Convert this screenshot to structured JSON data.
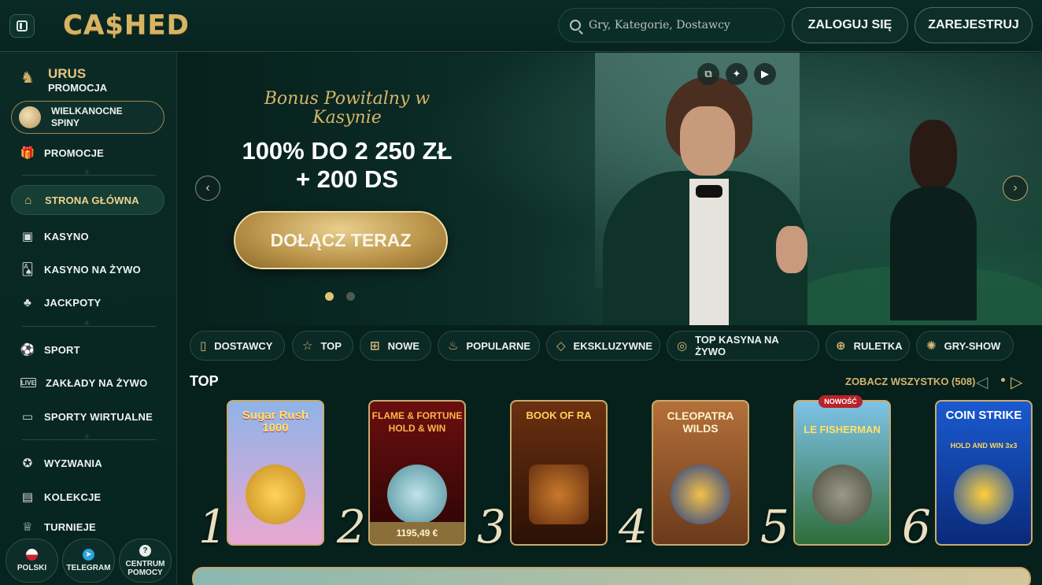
{
  "header": {
    "logo": "CA$HED",
    "search_placeholder": "Gry, Kategorie, Dostawcy",
    "login_label": "ZALOGUJ SIĘ",
    "register_label": "ZAREJESTRUJ"
  },
  "sidebar": {
    "urus_title": "URUS",
    "urus_subtitle": "PROMOCJA",
    "easter_label": "WIELKANOCNE SPINY",
    "items": [
      {
        "label": "PROMOCJE",
        "icon": "gift-icon"
      },
      {
        "label": "STRONA GŁÓWNA",
        "icon": "home-icon"
      },
      {
        "label": "KASYNO",
        "icon": "slot-icon"
      },
      {
        "label": "KASYNO NA ŻYWO",
        "icon": "cards-icon"
      },
      {
        "label": "JACKPOTY",
        "icon": "clover-icon"
      },
      {
        "label": "SPORT",
        "icon": "ball-icon"
      },
      {
        "label": "ZAKŁADY NA ŻYWO",
        "icon": "live-icon"
      },
      {
        "label": "SPORTY WIRTUALNE",
        "icon": "virtual-icon"
      },
      {
        "label": "WYZWANIA",
        "icon": "challenge-icon"
      },
      {
        "label": "KOLEKCJE",
        "icon": "collection-icon"
      },
      {
        "label": "TURNIEJE",
        "icon": "trophy-icon"
      }
    ],
    "bottom": [
      {
        "label": "POLSKI",
        "icon": "flag-pl-icon"
      },
      {
        "label": "TELEGRAM",
        "icon": "telegram-icon"
      },
      {
        "label": "CENTRUM POMOCY",
        "icon": "help-icon"
      }
    ]
  },
  "banner": {
    "script_text": "Bonus Powitalny w Kasynie",
    "headline": "100% DO 2 250 ZŁ + 200 DS",
    "cta_label": "DOŁĄCZ TERAZ",
    "active_slide": 1,
    "slide_count": 2
  },
  "categories": [
    {
      "label": "DOSTAWCY",
      "icon": "book-icon"
    },
    {
      "label": "TOP",
      "icon": "star-icon"
    },
    {
      "label": "NOWE",
      "icon": "gift-box-icon"
    },
    {
      "label": "POPULARNE",
      "icon": "flame-icon"
    },
    {
      "label": "EKSKLUZYWNE",
      "icon": "diamond-icon"
    },
    {
      "label": "TOP KASYNA NA ŻYWO",
      "icon": "medal-icon"
    },
    {
      "label": "RULETKA",
      "icon": "roulette-icon"
    },
    {
      "label": "GRY-SHOW",
      "icon": "wheel-icon"
    }
  ],
  "top_section": {
    "title": "TOP",
    "see_all": "ZOBACZ WSZYSTKO (508)",
    "games": [
      {
        "rank": "1",
        "title": "Sugar Rush 1000",
        "colors": [
          "#8fb3e8",
          "#e9a8d2"
        ]
      },
      {
        "rank": "2",
        "title": "FLAME & FORTUNE HOLD & WIN",
        "jackpot": "1195,49 €",
        "colors": [
          "#6b0f0f",
          "#2a0404"
        ]
      },
      {
        "rank": "3",
        "title": "BOOK OF RA",
        "colors": [
          "#6b3010",
          "#2a1005"
        ]
      },
      {
        "rank": "4",
        "title": "CLEOPATRA WILDS",
        "colors": [
          "#b4703a",
          "#6a3a1a"
        ]
      },
      {
        "rank": "5",
        "title": "LE FISHERMAN",
        "badge": "NOWOŚĆ",
        "colors": [
          "#7ec3e8",
          "#2f6d3a"
        ]
      },
      {
        "rank": "6",
        "title": "COIN STRIKE",
        "subtitle": "HOLD AND WIN 3x3",
        "colors": [
          "#1a5ad0",
          "#0a2a7a"
        ]
      }
    ]
  }
}
